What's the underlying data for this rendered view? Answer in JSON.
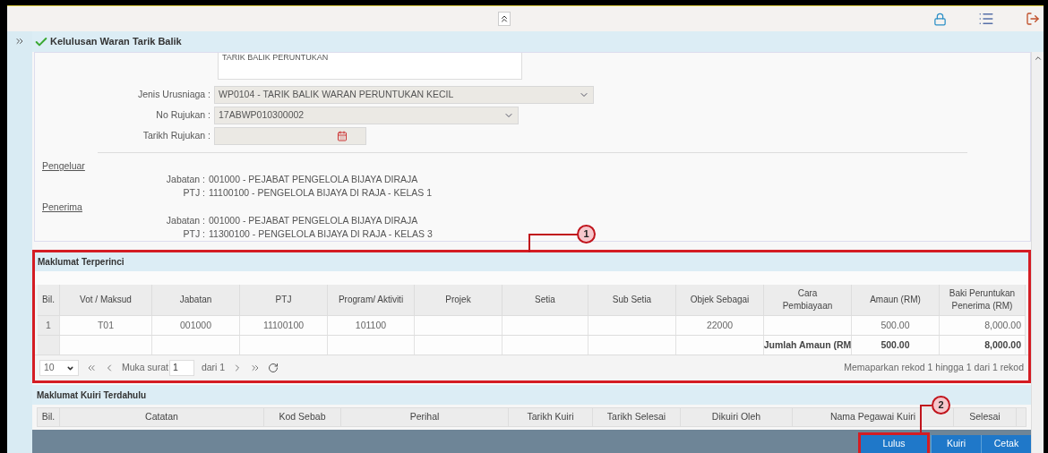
{
  "section": {
    "title": "Kelulusan Waran Tarik Balik"
  },
  "form": {
    "description": "TARIK BALIK PERUNTUKAN",
    "fields": [
      {
        "kind": "select",
        "label": "Jenis Urusniaga :",
        "value": "WP0104 - TARIK BALIK WARAN PERUNTUKAN KECIL",
        "wide": true
      },
      {
        "kind": "select",
        "label": "No Rujukan :",
        "value": "17ABWP010300002",
        "wide": false
      },
      {
        "kind": "date",
        "label": "Tarikh Rujukan :"
      }
    ]
  },
  "parties": [
    {
      "heading": "Pengeluar",
      "rows": [
        {
          "label": "Jabatan :",
          "value": "001000 - PEJABAT PENGELOLA BIJAYA DIRAJA"
        },
        {
          "label": "PTJ :",
          "value": "11100100 - PENGELOLA BIJAYA DI RAJA - KELAS 1"
        }
      ]
    },
    {
      "heading": "Penerima",
      "rows": [
        {
          "label": "Jabatan :",
          "value": "001000 - PEJABAT PENGELOLA BIJAYA DIRAJA"
        },
        {
          "label": "PTJ :",
          "value": "11300100 - PENGELOLA BIJAYA DI RAJA - KELAS 3"
        }
      ]
    }
  ],
  "details": {
    "title": "Maklumat Terperinci",
    "columns": [
      "Bil.",
      "Vot / Maksud",
      "Jabatan",
      "PTJ",
      "Program/ Aktiviti",
      "Projek",
      "Setia",
      "Sub Setia",
      "Objek Sebagai",
      "Cara Pembiayaan",
      "Amaun (RM)",
      "Baki Peruntukan Penerima (RM)"
    ],
    "rows": [
      {
        "kind": "data",
        "cells": [
          "1",
          "T01",
          "001000",
          "11100100",
          "101100",
          null,
          null,
          null,
          "22000",
          null,
          "500.00",
          "8,000.00"
        ]
      },
      {
        "kind": "total",
        "cells": [
          null,
          null,
          null,
          null,
          null,
          null,
          null,
          null,
          null,
          "Jumlah Amaun (RM",
          "500.00",
          "8,000.00"
        ]
      }
    ],
    "pager": {
      "page_size": "10",
      "page_label": "Muka surat",
      "page": "1",
      "of": "dari 1",
      "summary": "Memaparkan rekod 1 hingga 1 dari 1 rekod"
    }
  },
  "queries": {
    "title": "Maklumat Kuiri Terdahulu",
    "columns": [
      "Bil.",
      "Catatan",
      "Kod Sebab",
      "Perihal",
      "Tarikh Kuiri",
      "Tarikh Selesai",
      "Dikuiri Oleh",
      "Nama Pegawai Kuiri",
      "Selesai"
    ]
  },
  "buttons": [
    "Lulus",
    "Kuiri",
    "Cetak"
  ],
  "annotations": [
    {
      "label": "1"
    },
    {
      "label": "2"
    }
  ]
}
